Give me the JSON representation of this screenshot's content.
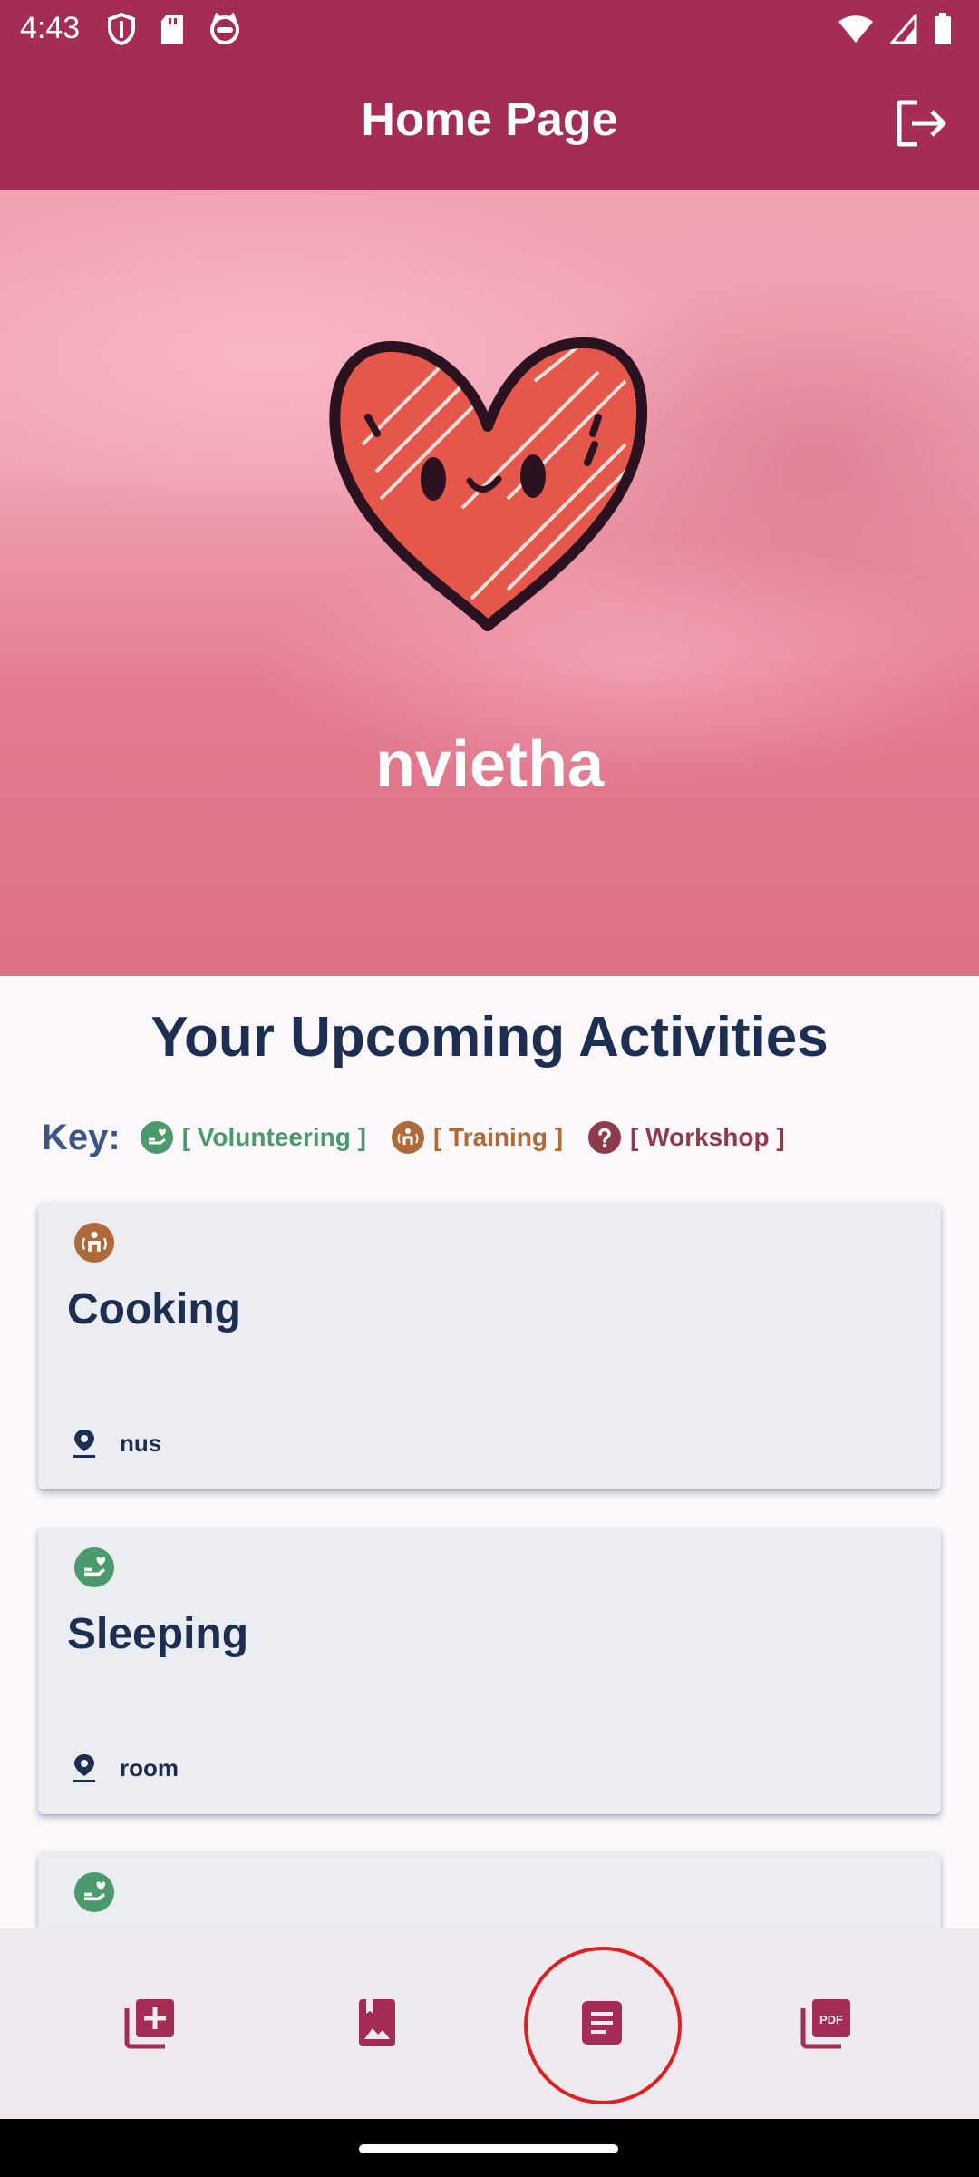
{
  "status_bar": {
    "time": "4:43",
    "left_icons": [
      "shield-icon",
      "sd-card-icon",
      "cat-icon"
    ],
    "right_icons": [
      "wifi-icon",
      "signal-icon",
      "battery-icon"
    ]
  },
  "app_bar": {
    "title": "Home Page",
    "logout_icon": "logout-icon",
    "background": "#a52c55"
  },
  "hero": {
    "username": "nvietha",
    "image": "heart-illustration"
  },
  "activities": {
    "title": "Your Upcoming Activities",
    "key_label": "Key:",
    "key": [
      {
        "label": "[ Volunteering ]",
        "color": "#4a9a6b",
        "icon": "volunteer-icon"
      },
      {
        "label": "[ Training ]",
        "color": "#b06a3a",
        "icon": "training-icon"
      },
      {
        "label": "[ Workshop ]",
        "color": "#8e3a4a",
        "icon": "help-icon"
      }
    ],
    "items": [
      {
        "title": "Cooking",
        "location": "nus",
        "type_icon": "training-icon"
      },
      {
        "title": "Sleeping",
        "location": "room",
        "type_icon": "volunteer-icon"
      },
      {
        "title": "",
        "location": "",
        "type_icon": "volunteer-icon"
      }
    ]
  },
  "bottom_nav": {
    "items": [
      "add-library-icon",
      "photo-album-icon",
      "article-icon",
      "pdf-icon"
    ],
    "selected_index": 2,
    "icon_color": "#a52c55"
  }
}
